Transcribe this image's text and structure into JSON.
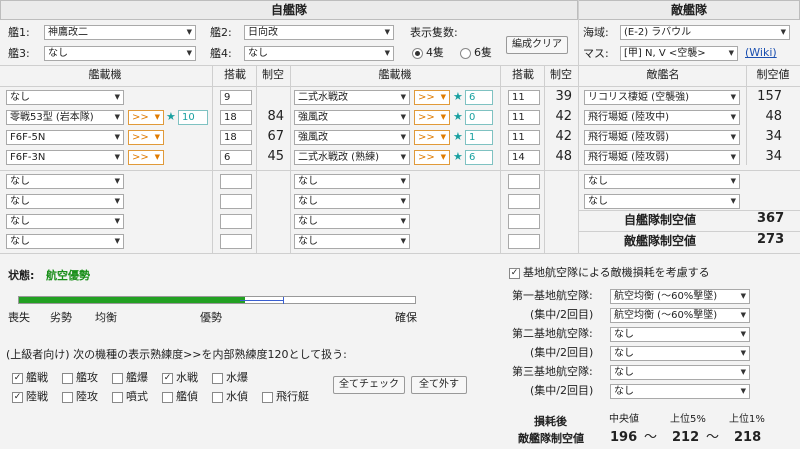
{
  "own_fleet": {
    "header": "自艦隊",
    "ship1_label": "艦1:",
    "ship1_value": "神鷹改二",
    "ship2_label": "艦2:",
    "ship2_value": "日向改",
    "ship3_label": "艦3:",
    "ship3_value": "なし",
    "ship4_label": "艦4:",
    "ship4_value": "なし",
    "count_label": "表示隻数:",
    "option4": "4隻",
    "option6": "6隻",
    "clear_button": "編成クリア"
  },
  "enemy_fleet": {
    "header": "敵艦隊",
    "area_label": "海域:",
    "area_value": "(E-2) ラバウル",
    "node_label": "マス:",
    "node_value": "[甲] N, V <空襲>",
    "wiki_link": "(Wiki)"
  },
  "table_headers": {
    "aircraft": "艦載機",
    "slots": "搭載",
    "air_power": "制空",
    "enemy_name": "敵艦名",
    "enemy_air": "制空値"
  },
  "rows": [
    {
      "l_plane": "なし",
      "l_slot": "9",
      "l_air": "",
      "r_plane": "二式水戦改",
      "r_prof": ">>",
      "r_star": "6",
      "r_slot": "11",
      "r_air": "39",
      "enemy": "リコリス棲姫 (空襲強)",
      "enemy_air": "157"
    },
    {
      "l_plane": "零戦53型 (岩本隊)",
      "l_prof": ">>",
      "l_star": "10",
      "l_slot": "18",
      "l_air": "84",
      "r_plane": "強風改",
      "r_prof": ">>",
      "r_star": "0",
      "r_slot": "11",
      "r_air": "42",
      "enemy": "飛行場姫 (陸攻中)",
      "enemy_air": "48"
    },
    {
      "l_plane": "F6F-5N",
      "l_prof": ">>",
      "l_slot": "18",
      "l_air": "67",
      "r_plane": "強風改",
      "r_prof": ">>",
      "r_star": "1",
      "r_slot": "11",
      "r_air": "42",
      "enemy": "飛行場姫 (陸攻弱)",
      "enemy_air": "34"
    },
    {
      "l_plane": "F6F-3N",
      "l_prof": ">>",
      "l_slot": "6",
      "l_air": "45",
      "r_plane": "二式水戦改 (熟練)",
      "r_prof": ">>",
      "r_star": "6",
      "r_slot": "14",
      "r_air": "48",
      "enemy": "飛行場姫 (陸攻弱)",
      "enemy_air": "34"
    },
    {
      "l_plane": "なし",
      "r_plane": "なし",
      "enemy": "なし"
    },
    {
      "l_plane": "なし",
      "r_plane": "なし",
      "enemy": "なし"
    },
    {
      "l_plane": "なし",
      "r_plane": "なし"
    },
    {
      "l_plane": "なし",
      "r_plane": "なし"
    }
  ],
  "totals": {
    "own_label": "自艦隊制空値",
    "own_value": "367",
    "enemy_label": "敵艦隊制空値",
    "enemy_value": "273"
  },
  "status": {
    "label": "状態:",
    "value": "航空優勢",
    "bar_fraction": 0.57,
    "ticks": [
      "喪失",
      "劣勢",
      "均衡",
      "優勢",
      "確保"
    ]
  },
  "advanced": {
    "text": "(上級者向け) 次の機種の表示熟練度>>を内部熟練度120として扱う:",
    "types": [
      {
        "name": "艦戦",
        "checked": true
      },
      {
        "name": "艦攻",
        "checked": false
      },
      {
        "name": "艦爆",
        "checked": false
      },
      {
        "name": "水戦",
        "checked": true
      },
      {
        "name": "水爆",
        "checked": false
      },
      {
        "name": "陸戦",
        "checked": true
      },
      {
        "name": "陸攻",
        "checked": false
      },
      {
        "name": "噴式",
        "checked": false
      },
      {
        "name": "艦偵",
        "checked": false
      },
      {
        "name": "水偵",
        "checked": false
      },
      {
        "name": "飛行艇",
        "checked": false
      }
    ],
    "check_all": "全てチェック",
    "uncheck_all": "全て外す"
  },
  "base": {
    "consider_label": "基地航空隊による敵機損耗を考慮する",
    "base1": "第一基地航空隊:",
    "base1_value": "航空均衡 (〜60%撃墜)",
    "base1_sub": "(集中/2回目)",
    "base1_sub_value": "航空均衡 (〜60%撃墜)",
    "base2": "第二基地航空隊:",
    "base2_value": "なし",
    "base2_sub": "(集中/2回目)",
    "base2_sub_value": "なし",
    "base3": "第三基地航空隊:",
    "base3_value": "なし",
    "base3_sub": "(集中/2回目)",
    "base3_sub_value": "なし"
  },
  "result": {
    "after_label": "損耗後",
    "median_label": "中央値",
    "top5_label": "上位5%",
    "top1_label": "上位1%",
    "enemy_air_label": "敵艦隊制空値",
    "median": "196",
    "top5": "212",
    "top1": "218",
    "sep": "〜"
  }
}
